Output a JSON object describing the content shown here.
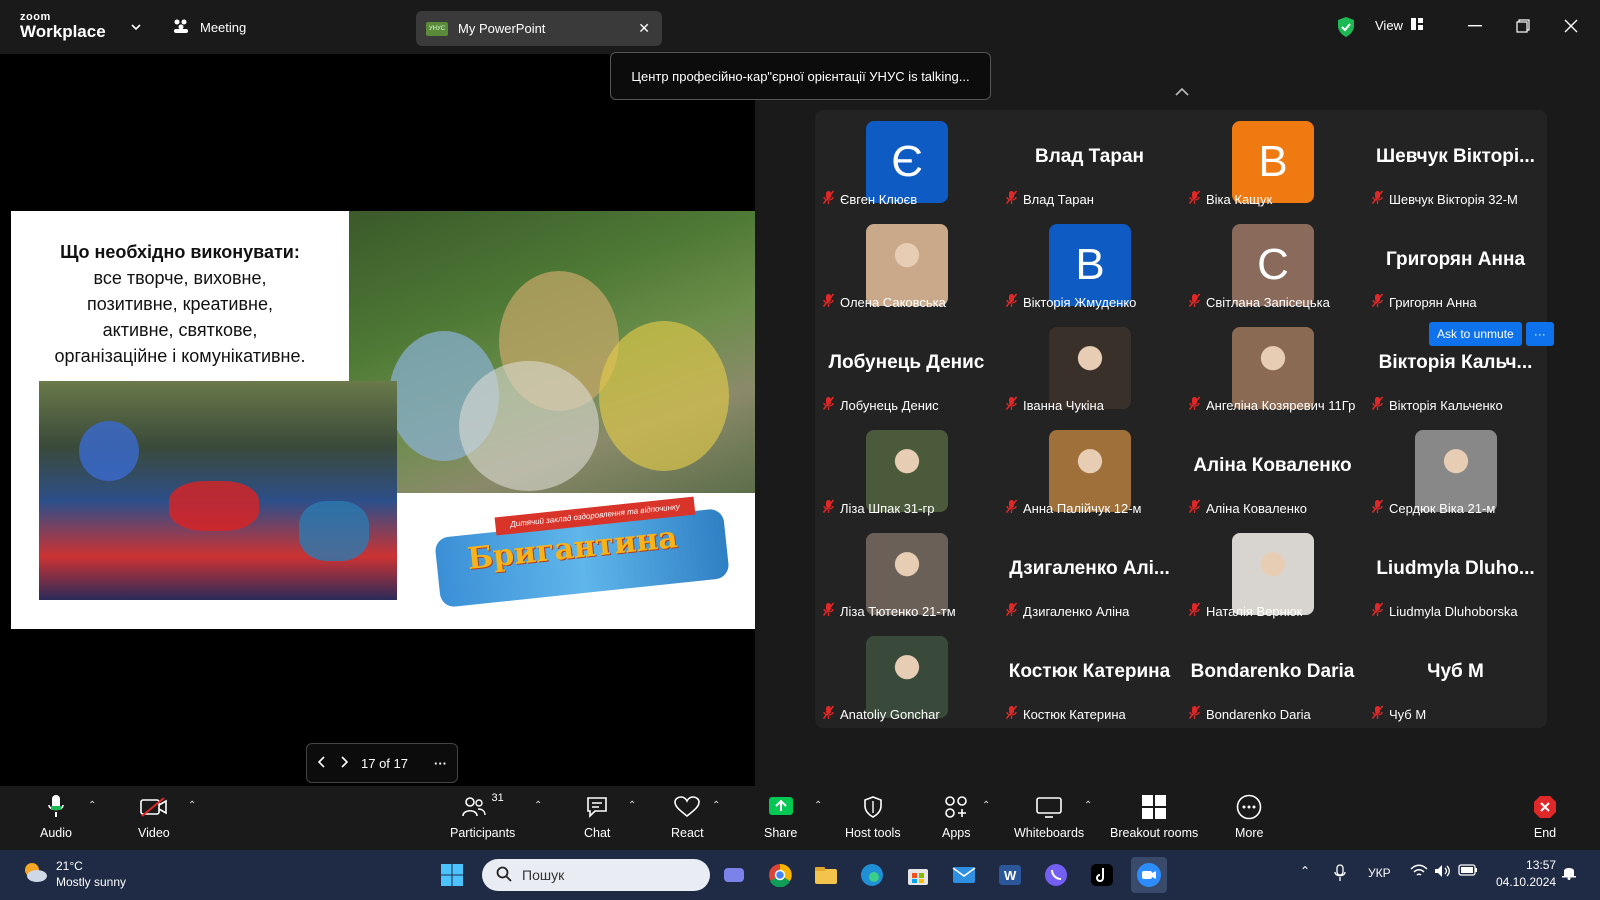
{
  "app": {
    "brand_top": "zoom",
    "brand_bottom": "Workplace",
    "meeting_label": "Meeting",
    "share_tab_title": "My PowerPoint",
    "share_thumb_text": "УНУС",
    "view_label": "View"
  },
  "toast": {
    "text": "Центр професійно-кар\"єрної орієнтації УНУС is talking..."
  },
  "slide": {
    "heading": "Що необхідно виконувати:",
    "body_lines": [
      "все творче, виховне,",
      "позитивне, креативне,",
      "активне, святкове,",
      "організаційне і комунікативне."
    ],
    "logo_text": "Бригантина",
    "logo_ribbon": "Дитячий заклад оздоровлення та відпочинку"
  },
  "slide_nav": {
    "counter": "17 of 17"
  },
  "participants": [
    {
      "name": "Євген Клюєв",
      "avatar_letter": "Є",
      "avatar_color": "#0e5bc4"
    },
    {
      "name": "Влад Таран",
      "big_name": "Влад Таран"
    },
    {
      "name": "Віка Кащук",
      "avatar_letter": "В",
      "avatar_color": "#f07a12"
    },
    {
      "name": "Шевчук Вікторія 32-М",
      "big_name": "Шевчук  Вікторі..."
    },
    {
      "name": "Олена Саковська",
      "photo": "#c9a98a"
    },
    {
      "name": "Вікторія Жмуденко",
      "avatar_letter": "В",
      "avatar_color": "#0e5bc4"
    },
    {
      "name": "Світлана Запісецька",
      "avatar_letter": "С",
      "avatar_color": "#8a6a5a"
    },
    {
      "name": "Григорян Анна",
      "big_name": "Григорян Анна"
    },
    {
      "name": "Лобунець Денис",
      "big_name": "Лобунець Денис"
    },
    {
      "name": "Іванна Чукіна",
      "photo": "#3a302a"
    },
    {
      "name": "Ангеліна Козяревич 11Гр",
      "photo": "#8a6a52"
    },
    {
      "name": "Вікторія Кальченко",
      "big_name": "Вікторія  Кальч..."
    },
    {
      "name": "Ліза Шпак 31-гр",
      "photo": "#4a5a3a"
    },
    {
      "name": "Анна Палійчук 12-м",
      "photo": "#a0703a"
    },
    {
      "name": "Аліна Коваленко",
      "big_name": "Аліна Коваленко"
    },
    {
      "name": "Сердюк Віка 21-м",
      "photo": "#888888"
    },
    {
      "name": "Ліза Тютенко 21-тм",
      "photo": "#6a6058"
    },
    {
      "name": "Дзигаленко Аліна",
      "big_name": "Дзигаленко  Алі..."
    },
    {
      "name": "Наталія Вернюк",
      "photo": "#d8d4d0"
    },
    {
      "name": "Liudmyla Dluhoborska",
      "big_name": "Liudmyla  Dluho..."
    },
    {
      "name": "Anatoliy Gonchar",
      "photo": "#3a4a3a"
    },
    {
      "name": "Костюк Катерина",
      "big_name": "Костюк Катерина"
    },
    {
      "name": "Bondarenko Daria",
      "big_name": "Bondarenko Daria"
    },
    {
      "name": "Чуб М",
      "big_name": "Чуб М"
    }
  ],
  "unmute_popup": {
    "ask_label": "Ask to unmute",
    "more_label": "···"
  },
  "toolbar": {
    "audio": "Audio",
    "video": "Video",
    "participants": "Participants",
    "participants_count": "31",
    "chat": "Chat",
    "react": "React",
    "share": "Share",
    "host_tools": "Host tools",
    "apps": "Apps",
    "whiteboards": "Whiteboards",
    "breakout": "Breakout rooms",
    "more": "More",
    "end": "End"
  },
  "taskbar": {
    "temp": "21°C",
    "weather": "Mostly sunny",
    "search_placeholder": "Пошук",
    "lang": "УКР",
    "time": "13:57",
    "date": "04.10.2024"
  },
  "colors": {
    "mic_muted": "#e02828",
    "accent_blue": "#0e72ed",
    "share_green": "#00c853",
    "end_red": "#e02828"
  }
}
